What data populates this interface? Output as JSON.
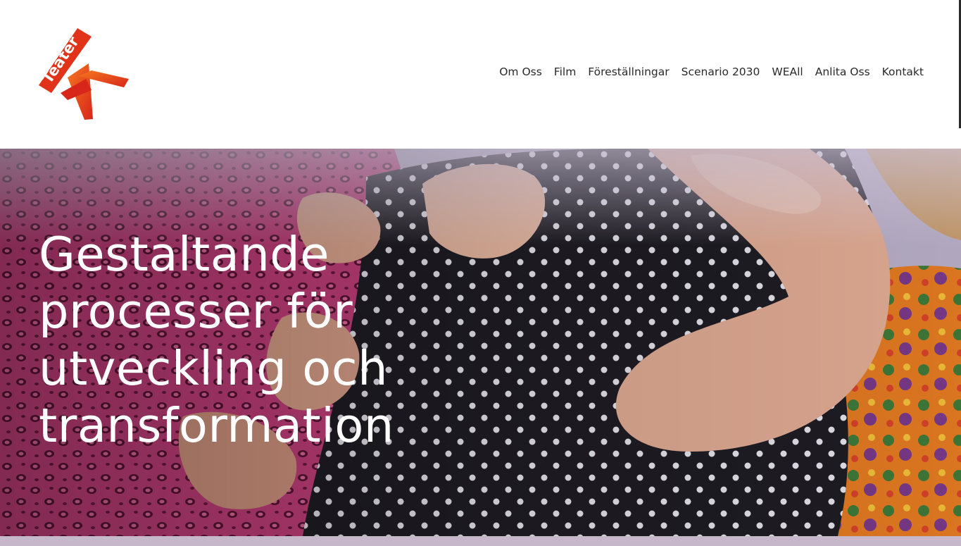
{
  "logo": {
    "text": "Teater",
    "letter": "K",
    "colors": {
      "primary": "#e0331a",
      "highlight": "#f06b1f",
      "text": "#ffffff"
    }
  },
  "nav": {
    "items": [
      {
        "label": "Om Oss"
      },
      {
        "label": "Film"
      },
      {
        "label": "Föreställningar"
      },
      {
        "label": "Scenario 2030"
      },
      {
        "label": "WEAll"
      },
      {
        "label": "Anlita Oss"
      },
      {
        "label": "Kontakt"
      }
    ]
  },
  "hero": {
    "title": "Gestaltande processer för utveckling och transformation",
    "image_description_colors": {
      "pink_fabric": "#c23a7a",
      "polka_fabric": "#1e1c22",
      "skin": "#e6b39a",
      "orange_fabric": "#e47a22"
    }
  },
  "colors": {
    "nav_text": "#2a2a2a",
    "bottom_band": "#c6b7cb"
  }
}
